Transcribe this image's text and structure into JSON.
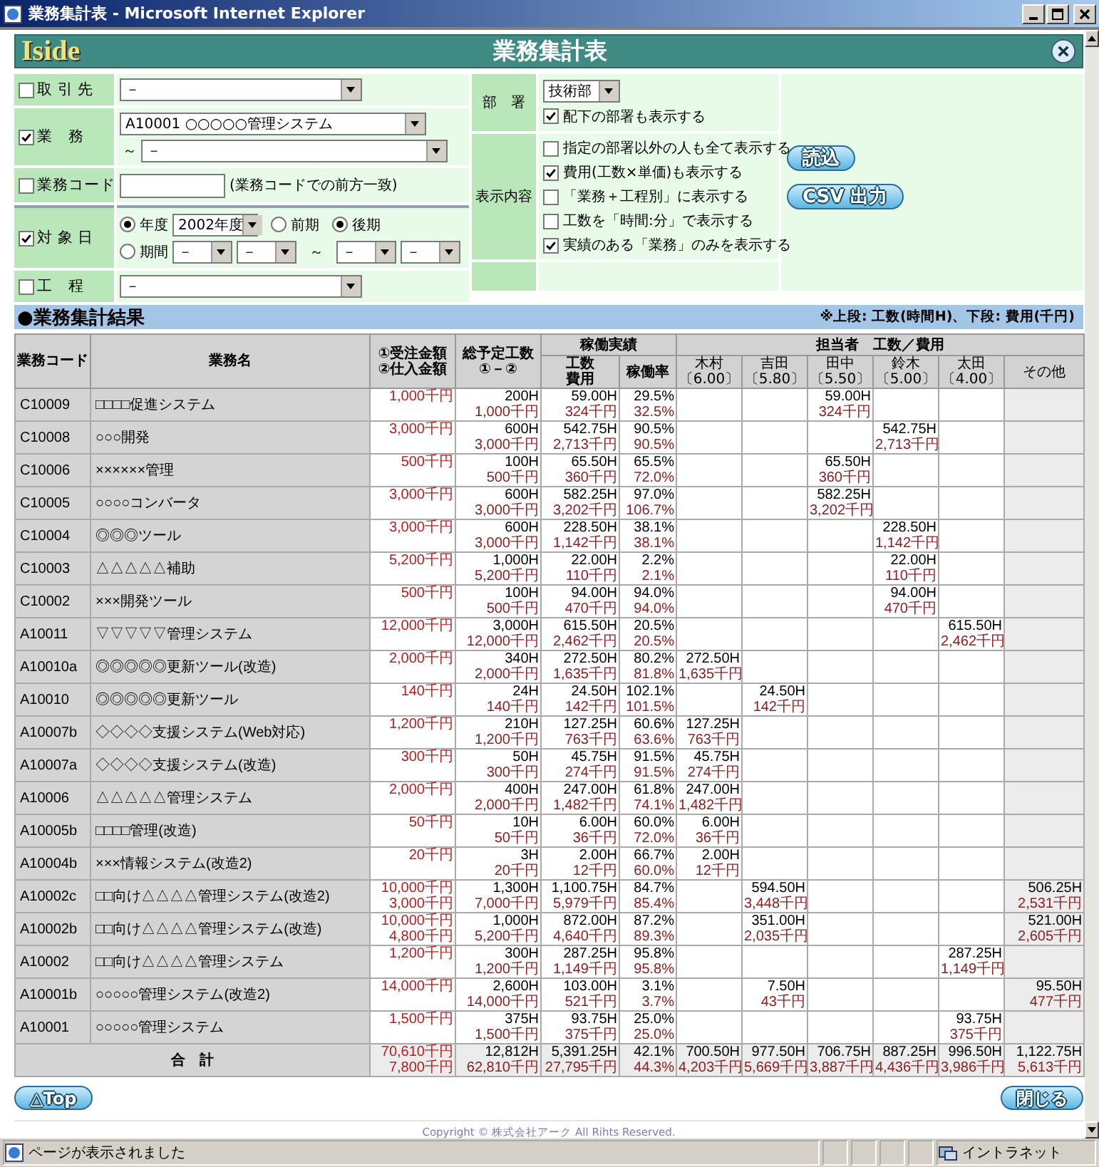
{
  "window": {
    "title": "業務集計表 - Microsoft Internet Explorer"
  },
  "header": {
    "logo": "Iside",
    "title": "業務集計表"
  },
  "filters": [
    {
      "kind": "select",
      "label": "取 引 先",
      "checked": false,
      "value": "－"
    },
    {
      "kind": "range",
      "label": "業　務",
      "checked": true,
      "from": "A10001 ○○○○○管理システム",
      "tilde": "～",
      "to": "－"
    },
    {
      "kind": "text",
      "label": "業務コード",
      "checked": false,
      "note": "(業務コードでの前方一致)"
    },
    {
      "kind": "date",
      "label": "対 象 日",
      "checked": true,
      "fiscal": {
        "label": "年度",
        "selected": true,
        "value": "2002年度"
      },
      "halves": [
        {
          "label": "前期",
          "selected": false
        },
        {
          "label": "後期",
          "selected": true
        }
      ],
      "period": {
        "label": "期間",
        "selected": false,
        "from": [
          "－",
          "－"
        ],
        "tilde": "～",
        "to": [
          "－",
          "－"
        ]
      }
    },
    {
      "kind": "select",
      "label": "工　程",
      "checked": false,
      "value": "－"
    }
  ],
  "department": {
    "label": "部　署",
    "value": "技術部",
    "option": {
      "label": "配下の部署も表示する",
      "checked": true
    }
  },
  "display": {
    "label": "表示内容",
    "options": [
      {
        "label": "指定の部署以外の人も全て表示する",
        "checked": false
      },
      {
        "label": "費用(工数×単価)も表示する",
        "checked": true
      },
      {
        "label": "「業務＋工程別」に表示する",
        "checked": false
      },
      {
        "label": "工数を「時間:分」で表示する",
        "checked": false
      },
      {
        "label": "実績のある「業務」のみを表示する",
        "checked": true
      }
    ]
  },
  "actions": [
    "読込",
    "CSV 出力"
  ],
  "results": {
    "title": "●業務集計結果",
    "note": "※上段: 工数(時間H)、下段: 費用(千円)",
    "headers": {
      "code": "業務コード",
      "name": "業務名",
      "amount": [
        "①受注金額",
        "②仕入金額"
      ],
      "planned": [
        "総予定工数",
        "①－②"
      ],
      "actual": {
        "label": "稼働実績",
        "work": [
          "工数",
          "費用"
        ],
        "rate": "稼働率"
      },
      "staff": {
        "label": "担当者　工数／費用",
        "people": [
          {
            "name": "木村",
            "rate": "〔6.00〕"
          },
          {
            "name": "吉田",
            "rate": "〔5.80〕"
          },
          {
            "name": "田中",
            "rate": "〔5.50〕"
          },
          {
            "name": "鈴木",
            "rate": "〔5.00〕"
          },
          {
            "name": "太田",
            "rate": "〔4.00〕"
          },
          {
            "name": "その他"
          }
        ]
      }
    },
    "rows": [
      {
        "code": "C10009",
        "name": "□□□□促進システム",
        "amount": [
          "1,000千円"
        ],
        "planned": [
          "200H",
          "1,000千円"
        ],
        "actual": [
          "59.00H",
          "324千円"
        ],
        "rate": [
          "29.5%",
          "32.5%"
        ],
        "staff": {
          "col_3": [
            "59.00H",
            "324千円"
          ]
        }
      },
      {
        "code": "C10008",
        "name": "○○○開発",
        "amount": [
          "3,000千円"
        ],
        "planned": [
          "600H",
          "3,000千円"
        ],
        "actual": [
          "542.75H",
          "2,713千円"
        ],
        "rate": [
          "90.5%",
          "90.5%"
        ],
        "staff": {
          "col_4": [
            "542.75H",
            "2,713千円"
          ]
        }
      },
      {
        "code": "C10006",
        "name": "××××××管理",
        "amount": [
          "500千円"
        ],
        "planned": [
          "100H",
          "500千円"
        ],
        "actual": [
          "65.50H",
          "360千円"
        ],
        "rate": [
          "65.5%",
          "72.0%"
        ],
        "staff": {
          "col_3": [
            "65.50H",
            "360千円"
          ]
        }
      },
      {
        "code": "C10005",
        "name": "○○○○コンバータ",
        "amount": [
          "3,000千円"
        ],
        "planned": [
          "600H",
          "3,000千円"
        ],
        "actual": [
          "582.25H",
          "3,202千円"
        ],
        "rate": [
          "97.0%",
          "106.7%"
        ],
        "staff": {
          "col_3": [
            "582.25H",
            "3,202千円"
          ]
        }
      },
      {
        "code": "C10004",
        "name": "◎◎◎ツール",
        "amount": [
          "3,000千円"
        ],
        "planned": [
          "600H",
          "3,000千円"
        ],
        "actual": [
          "228.50H",
          "1,142千円"
        ],
        "rate": [
          "38.1%",
          "38.1%"
        ],
        "staff": {
          "col_4": [
            "228.50H",
            "1,142千円"
          ]
        }
      },
      {
        "code": "C10003",
        "name": "△△△△△補助",
        "amount": [
          "5,200千円"
        ],
        "planned": [
          "1,000H",
          "5,200千円"
        ],
        "actual": [
          "22.00H",
          "110千円"
        ],
        "rate": [
          "2.2%",
          "2.1%"
        ],
        "staff": {
          "col_4": [
            "22.00H",
            "110千円"
          ]
        }
      },
      {
        "code": "C10002",
        "name": "×××開発ツール",
        "amount": [
          "500千円"
        ],
        "planned": [
          "100H",
          "500千円"
        ],
        "actual": [
          "94.00H",
          "470千円"
        ],
        "rate": [
          "94.0%",
          "94.0%"
        ],
        "staff": {
          "col_4": [
            "94.00H",
            "470千円"
          ]
        }
      },
      {
        "code": "A10011",
        "name": "▽▽▽▽▽管理システム",
        "amount": [
          "12,000千円"
        ],
        "planned": [
          "3,000H",
          "12,000千円"
        ],
        "actual": [
          "615.50H",
          "2,462千円"
        ],
        "rate": [
          "20.5%",
          "20.5%"
        ],
        "staff": {
          "col_5": [
            "615.50H",
            "2,462千円"
          ]
        }
      },
      {
        "code": "A10010a",
        "name": "◎◎◎◎◎更新ツール(改造)",
        "amount": [
          "2,000千円"
        ],
        "planned": [
          "340H",
          "2,000千円"
        ],
        "actual": [
          "272.50H",
          "1,635千円"
        ],
        "rate": [
          "80.2%",
          "81.8%"
        ],
        "staff": {
          "col_1": [
            "272.50H",
            "1,635千円"
          ]
        }
      },
      {
        "code": "A10010",
        "name": "◎◎◎◎◎更新ツール",
        "amount": [
          "140千円"
        ],
        "planned": [
          "24H",
          "140千円"
        ],
        "actual": [
          "24.50H",
          "142千円"
        ],
        "rate": [
          "102.1%",
          "101.5%"
        ],
        "staff": {
          "col_2": [
            "24.50H",
            "142千円"
          ]
        }
      },
      {
        "code": "A10007b",
        "name": "◇◇◇◇支援システム(Web対応)",
        "amount": [
          "1,200千円"
        ],
        "planned": [
          "210H",
          "1,200千円"
        ],
        "actual": [
          "127.25H",
          "763千円"
        ],
        "rate": [
          "60.6%",
          "63.6%"
        ],
        "staff": {
          "col_1": [
            "127.25H",
            "763千円"
          ]
        }
      },
      {
        "code": "A10007a",
        "name": "◇◇◇◇支援システム(改造)",
        "amount": [
          "300千円"
        ],
        "planned": [
          "50H",
          "300千円"
        ],
        "actual": [
          "45.75H",
          "274千円"
        ],
        "rate": [
          "91.5%",
          "91.5%"
        ],
        "staff": {
          "col_1": [
            "45.75H",
            "274千円"
          ]
        }
      },
      {
        "code": "A10006",
        "name": "△△△△△管理システム",
        "amount": [
          "2,000千円"
        ],
        "planned": [
          "400H",
          "2,000千円"
        ],
        "actual": [
          "247.00H",
          "1,482千円"
        ],
        "rate": [
          "61.8%",
          "74.1%"
        ],
        "staff": {
          "col_1": [
            "247.00H",
            "1,482千円"
          ]
        }
      },
      {
        "code": "A10005b",
        "name": "□□□□管理(改造)",
        "amount": [
          "50千円"
        ],
        "planned": [
          "10H",
          "50千円"
        ],
        "actual": [
          "6.00H",
          "36千円"
        ],
        "rate": [
          "60.0%",
          "72.0%"
        ],
        "staff": {
          "col_1": [
            "6.00H",
            "36千円"
          ]
        }
      },
      {
        "code": "A10004b",
        "name": "×××情報システム(改造2)",
        "amount": [
          "20千円"
        ],
        "planned": [
          "3H",
          "20千円"
        ],
        "actual": [
          "2.00H",
          "12千円"
        ],
        "rate": [
          "66.7%",
          "60.0%"
        ],
        "staff": {
          "col_1": [
            "2.00H",
            "12千円"
          ]
        }
      },
      {
        "code": "A10002c",
        "name": "□□向け△△△△管理システム(改造2)",
        "amount": [
          "10,000千円",
          "3,000千円"
        ],
        "planned": [
          "1,300H",
          "7,000千円"
        ],
        "actual": [
          "1,100.75H",
          "5,979千円"
        ],
        "rate": [
          "84.7%",
          "85.4%"
        ],
        "staff": {
          "col_2": [
            "594.50H",
            "3,448千円"
          ],
          "col_6": [
            "506.25H",
            "2,531千円"
          ]
        }
      },
      {
        "code": "A10002b",
        "name": "□□向け△△△△管理システム(改造)",
        "amount": [
          "10,000千円",
          "4,800千円"
        ],
        "planned": [
          "1,000H",
          "5,200千円"
        ],
        "actual": [
          "872.00H",
          "4,640千円"
        ],
        "rate": [
          "87.2%",
          "89.3%"
        ],
        "staff": {
          "col_2": [
            "351.00H",
            "2,035千円"
          ],
          "col_6": [
            "521.00H",
            "2,605千円"
          ]
        }
      },
      {
        "code": "A10002",
        "name": "□□向け△△△△管理システム",
        "amount": [
          "1,200千円"
        ],
        "planned": [
          "300H",
          "1,200千円"
        ],
        "actual": [
          "287.25H",
          "1,149千円"
        ],
        "rate": [
          "95.8%",
          "95.8%"
        ],
        "staff": {
          "col_5": [
            "287.25H",
            "1,149千円"
          ]
        }
      },
      {
        "code": "A10001b",
        "name": "○○○○○管理システム(改造2)",
        "amount": [
          "14,000千円"
        ],
        "planned": [
          "2,600H",
          "14,000千円"
        ],
        "actual": [
          "103.00H",
          "521千円"
        ],
        "rate": [
          "3.1%",
          "3.7%"
        ],
        "staff": {
          "col_2": [
            "7.50H",
            "43千円"
          ],
          "col_6": [
            "95.50H",
            "477千円"
          ]
        }
      },
      {
        "code": "A10001",
        "name": "○○○○○管理システム",
        "amount": [
          "1,500千円"
        ],
        "planned": [
          "375H",
          "1,500千円"
        ],
        "actual": [
          "93.75H",
          "375千円"
        ],
        "rate": [
          "25.0%",
          "25.0%"
        ],
        "staff": {
          "col_5": [
            "93.75H",
            "375千円"
          ]
        }
      }
    ],
    "total": {
      "label": "合　計",
      "amount": [
        "70,610千円",
        "7,800千円"
      ],
      "planned": [
        "12,812H",
        "62,810千円"
      ],
      "actual": [
        "5,391.25H",
        "27,795千円"
      ],
      "rate": [
        "42.1%",
        "44.3%"
      ],
      "staff": {
        "col_1": [
          "700.50H",
          "4,203千円"
        ],
        "col_2": [
          "977.50H",
          "5,669千円"
        ],
        "col_3": [
          "706.75H",
          "3,887千円"
        ],
        "col_4": [
          "887.25H",
          "4,436千円"
        ],
        "col_5": [
          "996.50H",
          "3,986千円"
        ],
        "col_6": [
          "1,122.75H",
          "5,613千円"
        ]
      }
    }
  },
  "footer": {
    "top_button": "△Top",
    "close_button": "閉じる",
    "copyright": "Copyright © 株式会社アーク All Rihts Reserved."
  },
  "status_bar": {
    "text": "ページが表示されました",
    "zone": "イントラネット"
  }
}
